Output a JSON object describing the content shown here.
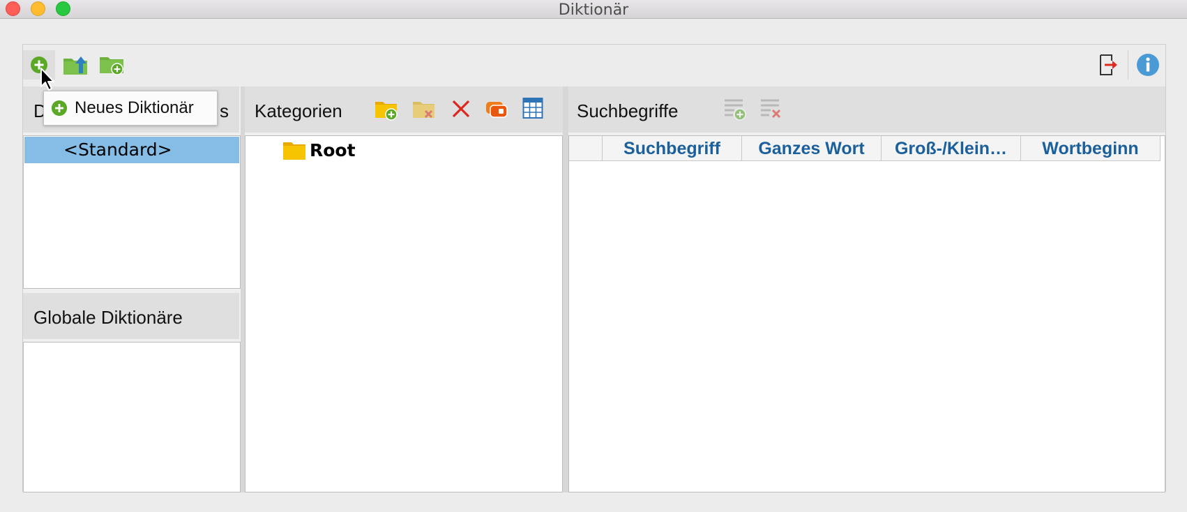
{
  "window": {
    "title": "Diktionär"
  },
  "toolbar": {
    "new_dictionary_icon": "plus-circle-green",
    "import_icon": "folder-upload",
    "add_folder_icon": "folder-add",
    "exit_icon": "exit-arrow",
    "info_icon": "info-circle"
  },
  "tooltip": {
    "text": "Neues Diktionär"
  },
  "left_panel": {
    "header_partial": "D",
    "header_partial_suffix": "s",
    "items": [
      {
        "label": "<Standard>",
        "selected": true
      }
    ],
    "global_header": "Globale Diktionäre"
  },
  "categories": {
    "header": "Kategorien",
    "tools": [
      "folder-add-icon",
      "folder-remove-icon",
      "delete-x-icon",
      "tag-icon",
      "table-icon"
    ],
    "tree": [
      {
        "label": "Root"
      }
    ]
  },
  "search_terms": {
    "header": "Suchbegriffe",
    "tools": [
      "add-term-icon",
      "remove-term-icon"
    ],
    "columns": [
      "Suchbegriff",
      "Ganzes Wort",
      "Groß-/Klein…",
      "Wortbeginn"
    ]
  },
  "colors": {
    "accent_green": "#5aa826",
    "selection_blue": "#86bde6",
    "header_text_blue": "#1b5f9b",
    "delete_red": "#d9281e"
  }
}
